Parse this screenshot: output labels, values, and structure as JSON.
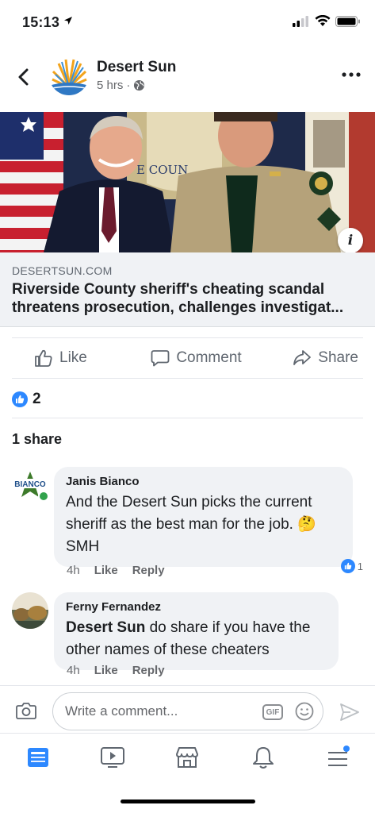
{
  "status_bar": {
    "time": "15:13"
  },
  "post": {
    "page_name": "Desert Sun",
    "time_ago": "5 hrs",
    "meta_separator": "·",
    "more_label": "More options",
    "link": {
      "domain": "DESERTSUN.COM",
      "title": "Riverside County sheriff's cheating scandal threatens prosecution, challenges investigat...",
      "image_text": "E COUN"
    },
    "actions": [
      {
        "label": "Like",
        "icon": "thumbs-up-icon"
      },
      {
        "label": "Comment",
        "icon": "speech-bubble-icon"
      },
      {
        "label": "Share",
        "icon": "share-arrow-icon"
      }
    ],
    "reaction_count": "2",
    "share_count": "1 share"
  },
  "comments": [
    {
      "author": "Janis Bianco",
      "text": "And the Desert Sun picks the current sheriff as the best man for the job. 🤔 SMH",
      "time": "4h",
      "like": "Like",
      "reply": "Reply",
      "reaction_count": "1",
      "avatar_text": "BIANCO"
    },
    {
      "author": "Ferny Fernandez",
      "text_bold": "Desert Sun",
      "text": " do share if you have the other names of these cheaters",
      "time": "4h",
      "like": "Like",
      "reply": "Reply"
    }
  ],
  "composer": {
    "placeholder": "Write a comment...",
    "gif_label": "GIF"
  },
  "colors": {
    "accent": "#2d88ff",
    "muted": "#65676b",
    "bubble": "#f0f2f5",
    "online": "#31a24c"
  }
}
